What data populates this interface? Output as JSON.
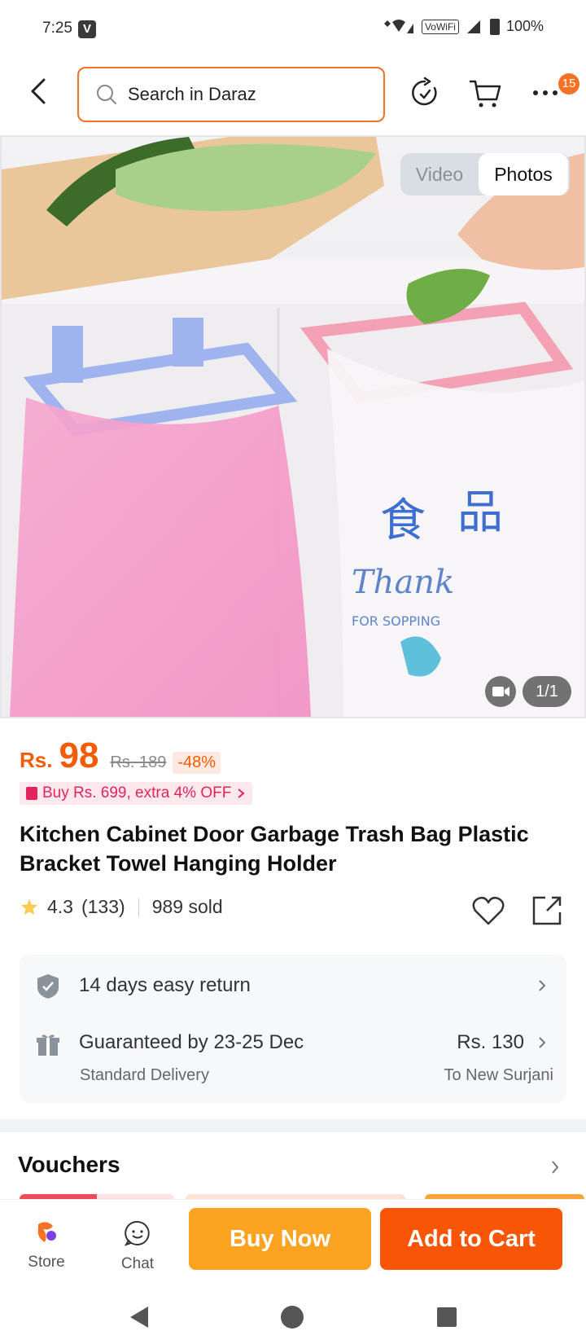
{
  "status_bar": {
    "time": "7:25",
    "carrier_badge": "V",
    "vowifi": "VoWiFi",
    "battery": "100%"
  },
  "search": {
    "placeholder": "Search in Daraz"
  },
  "nav": {
    "cart_badge": "15"
  },
  "gallery": {
    "tab_video": "Video",
    "tab_photos": "Photos",
    "counter": "1/1",
    "image_text_1": "Thank",
    "image_text_2": "FOR SOPPING"
  },
  "price": {
    "currency": "Rs.",
    "current": "98",
    "original": "Rs. 189",
    "discount": "-48%"
  },
  "promo": {
    "label": "Buy Rs. 699, extra 4% OFF"
  },
  "product": {
    "title": "Kitchen Cabinet Door Garbage Trash Bag Plastic Bracket Towel Hanging Holder",
    "rating": "4.3",
    "reviews": "(133)",
    "sold": "989 sold"
  },
  "service": {
    "return_label": "14 days easy return",
    "delivery_label": "Guaranteed by 23-25 Dec",
    "delivery_sub": "Standard Delivery",
    "delivery_price": "Rs. 130",
    "delivery_to": "To New Surjani"
  },
  "vouchers": {
    "title": "Vouchers"
  },
  "bottom_bar": {
    "store": "Store",
    "chat": "Chat",
    "buy_now": "Buy Now",
    "add_to_cart": "Add to Cart"
  },
  "colors": {
    "accent": "#f57224",
    "price": "#f35b04",
    "buy_now": "#fca422",
    "add_to_cart": "#f85606",
    "promo": "#e0245e"
  }
}
